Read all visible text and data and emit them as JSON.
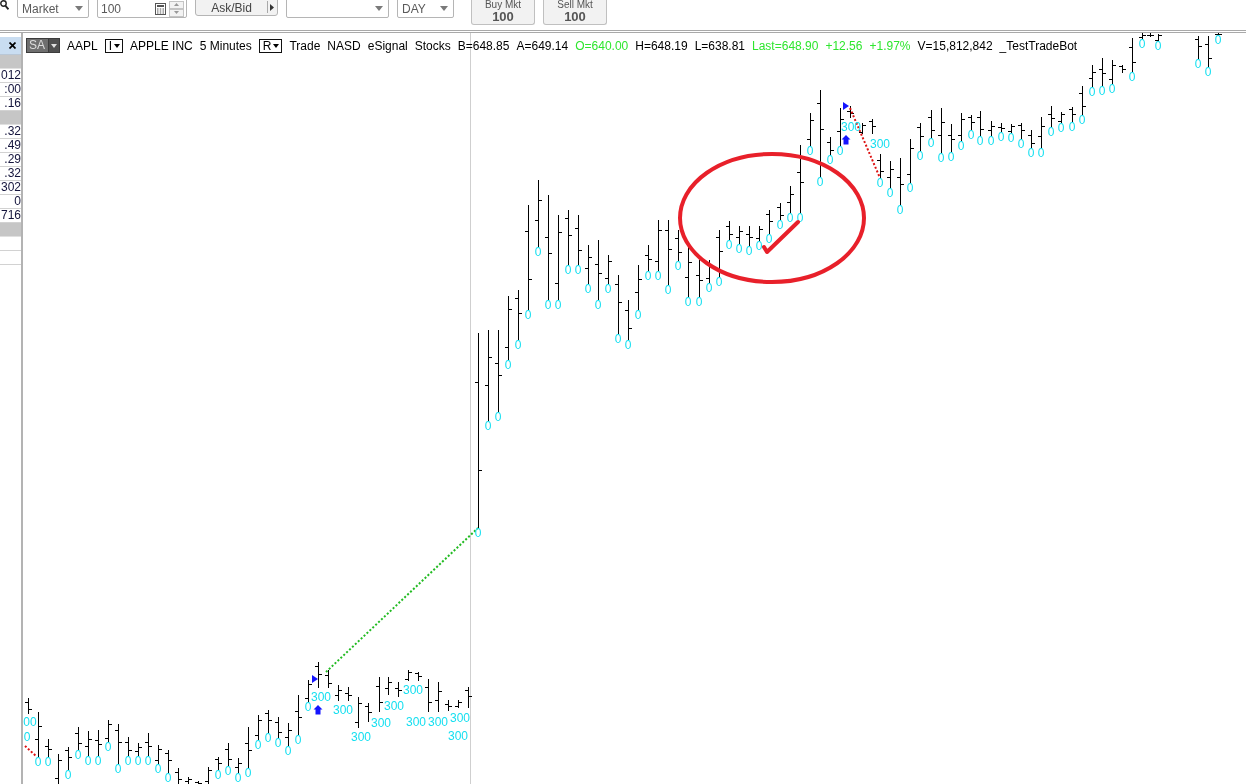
{
  "order_bar": {
    "controls": [
      {
        "kind": "dropdown",
        "value": "Market"
      },
      {
        "kind": "spinner",
        "value": "100"
      },
      {
        "kind": "split_button",
        "label": "Ask/Bid"
      },
      {
        "kind": "dropdown"
      },
      {
        "kind": "dropdown",
        "value": "DAY"
      },
      {
        "kind": "order_button",
        "label": "Buy Mkt",
        "quantity": "100"
      },
      {
        "kind": "order_button",
        "label": "Sell Mkt",
        "quantity": "100"
      }
    ]
  },
  "side_panel": {
    "rows": [
      {
        "kind": "header"
      },
      {
        "kind": "section"
      },
      {
        "kind": "value",
        "text": "012"
      },
      {
        "kind": "value",
        "text": ":00"
      },
      {
        "kind": "value",
        "text": ".16"
      },
      {
        "kind": "section"
      },
      {
        "kind": "value",
        "text": ".32"
      },
      {
        "kind": "value",
        "text": ".49"
      },
      {
        "kind": "value",
        "text": ".29"
      },
      {
        "kind": "value",
        "text": ".32"
      },
      {
        "kind": "value",
        "text": "302"
      },
      {
        "kind": "value",
        "text": "0"
      },
      {
        "kind": "value",
        "text": "716"
      },
      {
        "kind": "section"
      },
      {
        "kind": "empty"
      },
      {
        "kind": "empty"
      }
    ]
  },
  "chart": {
    "header": [
      {
        "kind": "symbol_menu",
        "text": "SA"
      },
      {
        "kind": "label",
        "text": "AAPL"
      },
      {
        "kind": "menu",
        "text": "I"
      },
      {
        "kind": "label",
        "text": "APPLE INC"
      },
      {
        "kind": "label",
        "text": "5 Minutes"
      },
      {
        "kind": "menu",
        "text": "R"
      },
      {
        "kind": "label",
        "text": "Trade"
      },
      {
        "kind": "label",
        "text": "NASD"
      },
      {
        "kind": "label",
        "text": "eSignal"
      },
      {
        "kind": "label",
        "text": "Stocks"
      },
      {
        "kind": "quote",
        "text": "B=648.85",
        "color": "#000000"
      },
      {
        "kind": "quote",
        "text": "A=649.14",
        "color": "#000000"
      },
      {
        "kind": "quote",
        "text": "O=640.00",
        "color": "#2ee62e"
      },
      {
        "kind": "quote",
        "text": "H=648.19",
        "color": "#000000"
      },
      {
        "kind": "quote",
        "text": "L=638.81",
        "color": "#000000"
      },
      {
        "kind": "quote",
        "text": "Last=648.90",
        "color": "#2ee62e"
      },
      {
        "kind": "quote",
        "text": "+12.56",
        "color": "#2ee62e"
      },
      {
        "kind": "quote",
        "text": "+1.97%",
        "color": "#2ee62e"
      },
      {
        "kind": "quote",
        "text": "V=15,812,842",
        "color": "#000000"
      },
      {
        "kind": "label",
        "text": "_TestTradeBot"
      }
    ],
    "left_session_labels": [
      "0",
      "00",
      "0",
      "0",
      "0",
      "0",
      "0",
      "0",
      "0",
      "0",
      "0",
      "0",
      "0",
      "0",
      "0",
      "0",
      "0",
      "0",
      "0",
      "0",
      "0",
      "0",
      "0",
      "0",
      "0",
      "300",
      "300",
      "300",
      "300",
      "300",
      "300",
      "300",
      "300",
      "300",
      "300"
    ],
    "right_session_labels": [
      "0",
      "0",
      "0",
      "0",
      "0",
      "0",
      "0",
      "0",
      "0",
      "0",
      "0",
      "0",
      "0",
      "0",
      "0",
      "0",
      "0",
      "0",
      "0",
      "0",
      "0",
      "0",
      "0",
      "0",
      "0",
      "0",
      "0",
      "0",
      "0",
      "0",
      "0",
      "0",
      "0",
      "0",
      "0",
      "0",
      "0",
      "300",
      "300",
      "0",
      "0",
      "0",
      "0",
      "0",
      "0",
      "0",
      "0",
      "0",
      "0",
      "0",
      "0",
      "0",
      "0",
      "0",
      "0",
      "0",
      "0",
      "0",
      "0",
      "0",
      "0",
      "0",
      "0",
      "0",
      "0",
      "0",
      "0",
      "0",
      "0"
    ]
  }
}
